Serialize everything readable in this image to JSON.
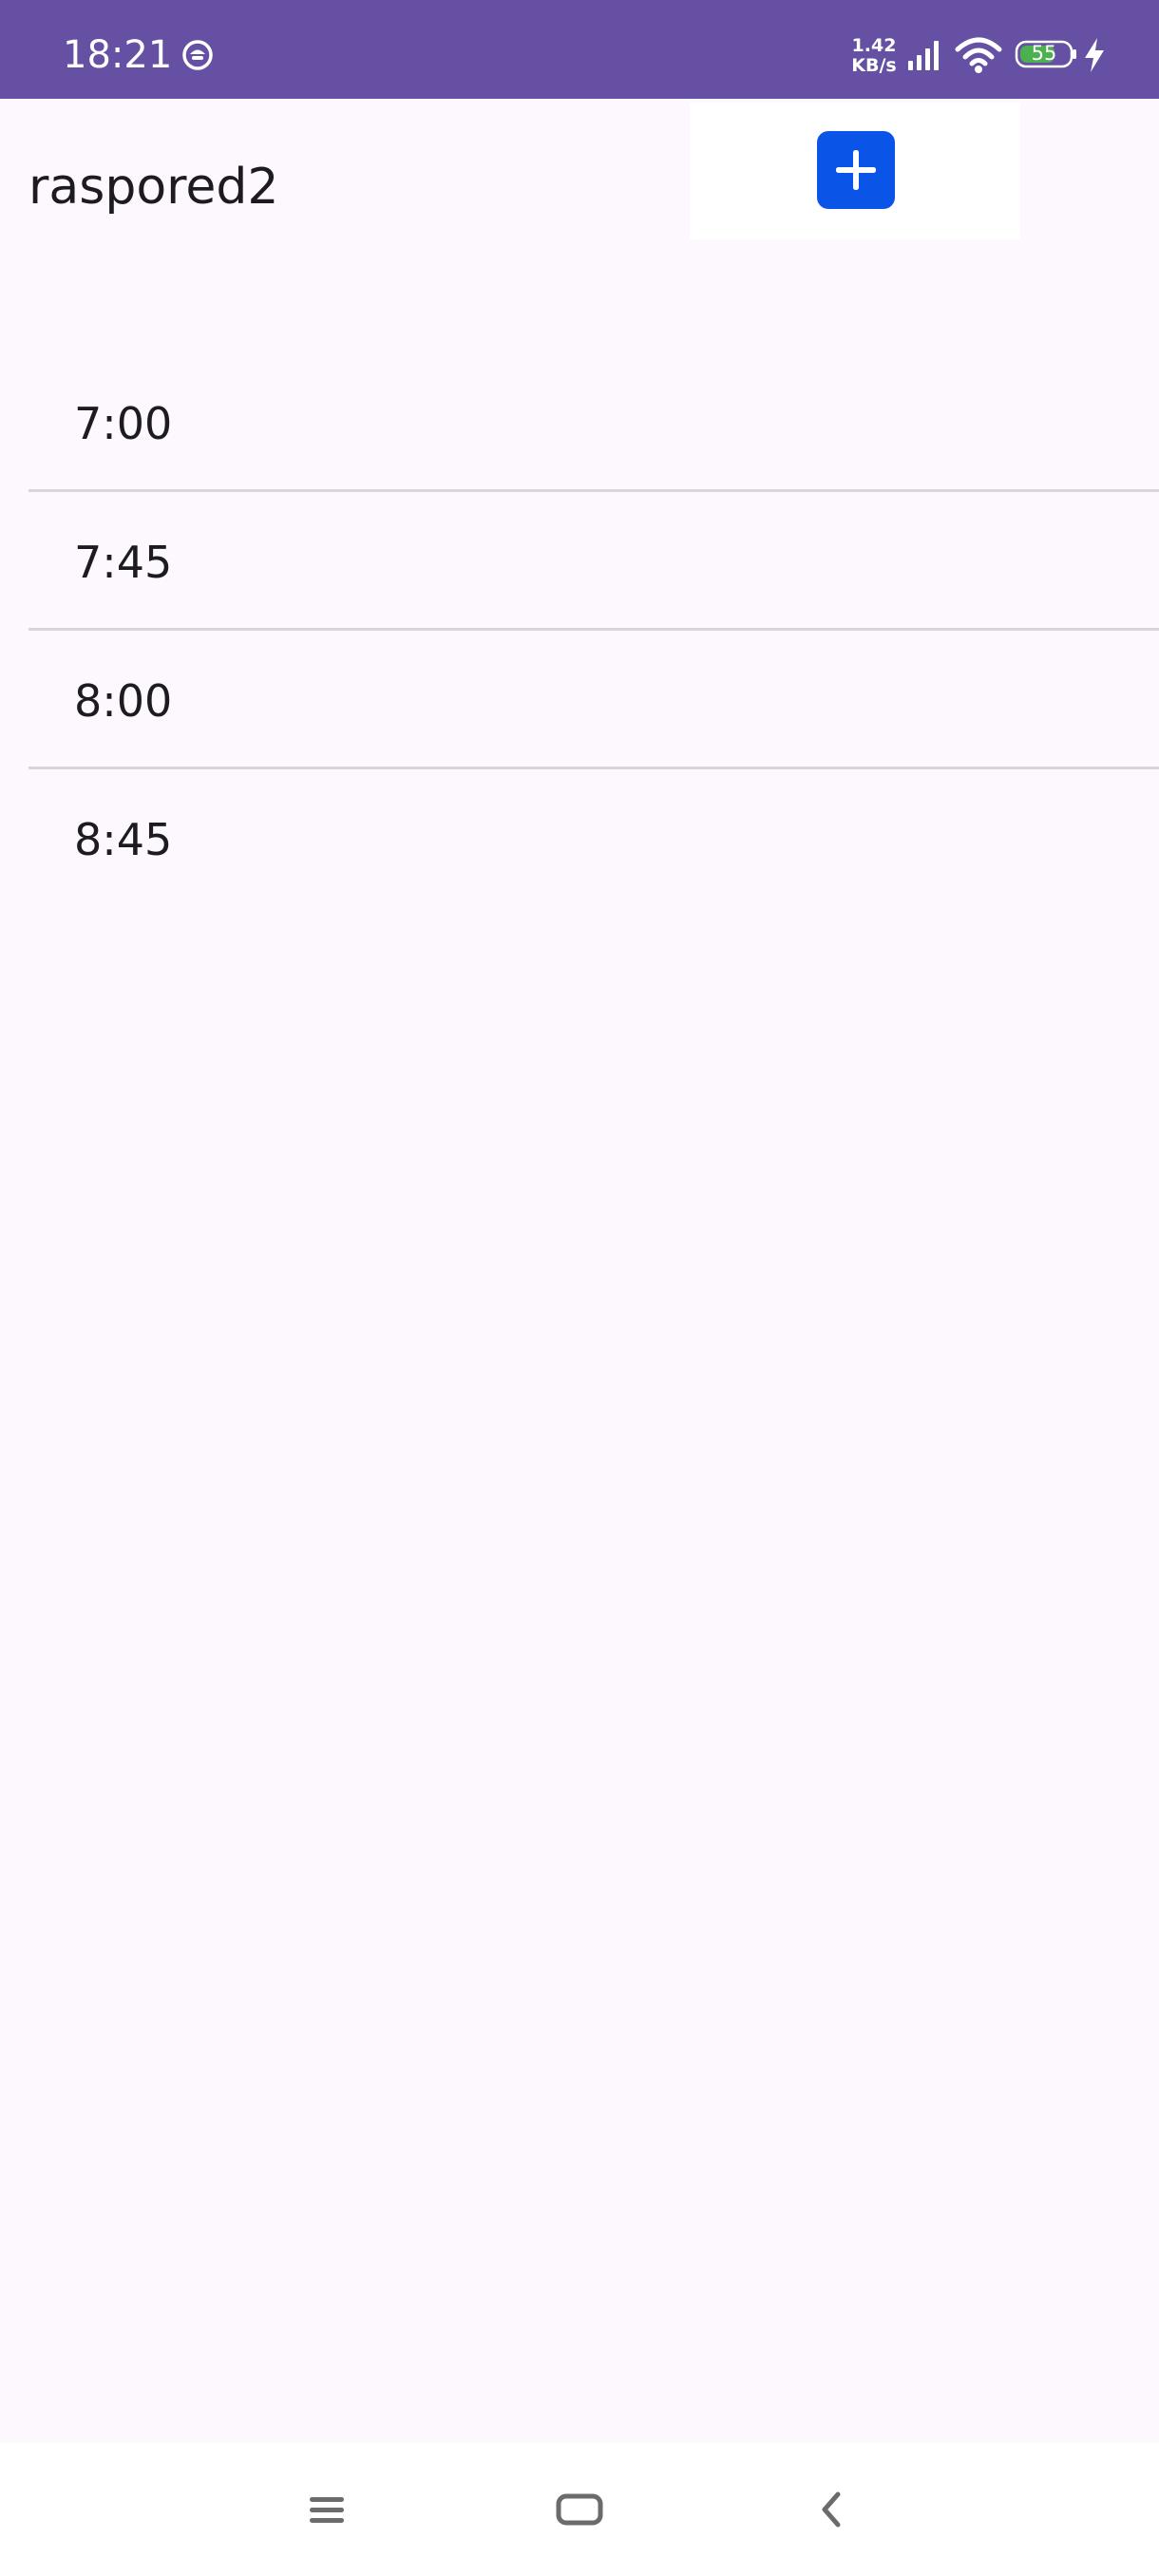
{
  "status_bar": {
    "time": "18:21",
    "app_icon": "notification-app-icon",
    "net_speed_value": "1.42",
    "net_speed_unit": "KB/s",
    "battery_level": "55",
    "icons": [
      "signal-icon",
      "wifi-icon",
      "battery-icon",
      "charging-icon"
    ],
    "background_color": "#6650a4"
  },
  "toolbar": {
    "title": "raspored2",
    "add_button_icon": "plus-icon",
    "add_button_color": "#0a55e8"
  },
  "list": {
    "items": [
      {
        "label": "7:00"
      },
      {
        "label": "7:45"
      },
      {
        "label": "8:00"
      },
      {
        "label": "8:45"
      }
    ]
  },
  "nav_bar": {
    "icons": [
      "menu-icon",
      "home-icon",
      "back-icon"
    ]
  },
  "colors": {
    "background": "#fdf7fe",
    "divider": "#d8d4dc",
    "text": "#1d1b20"
  }
}
